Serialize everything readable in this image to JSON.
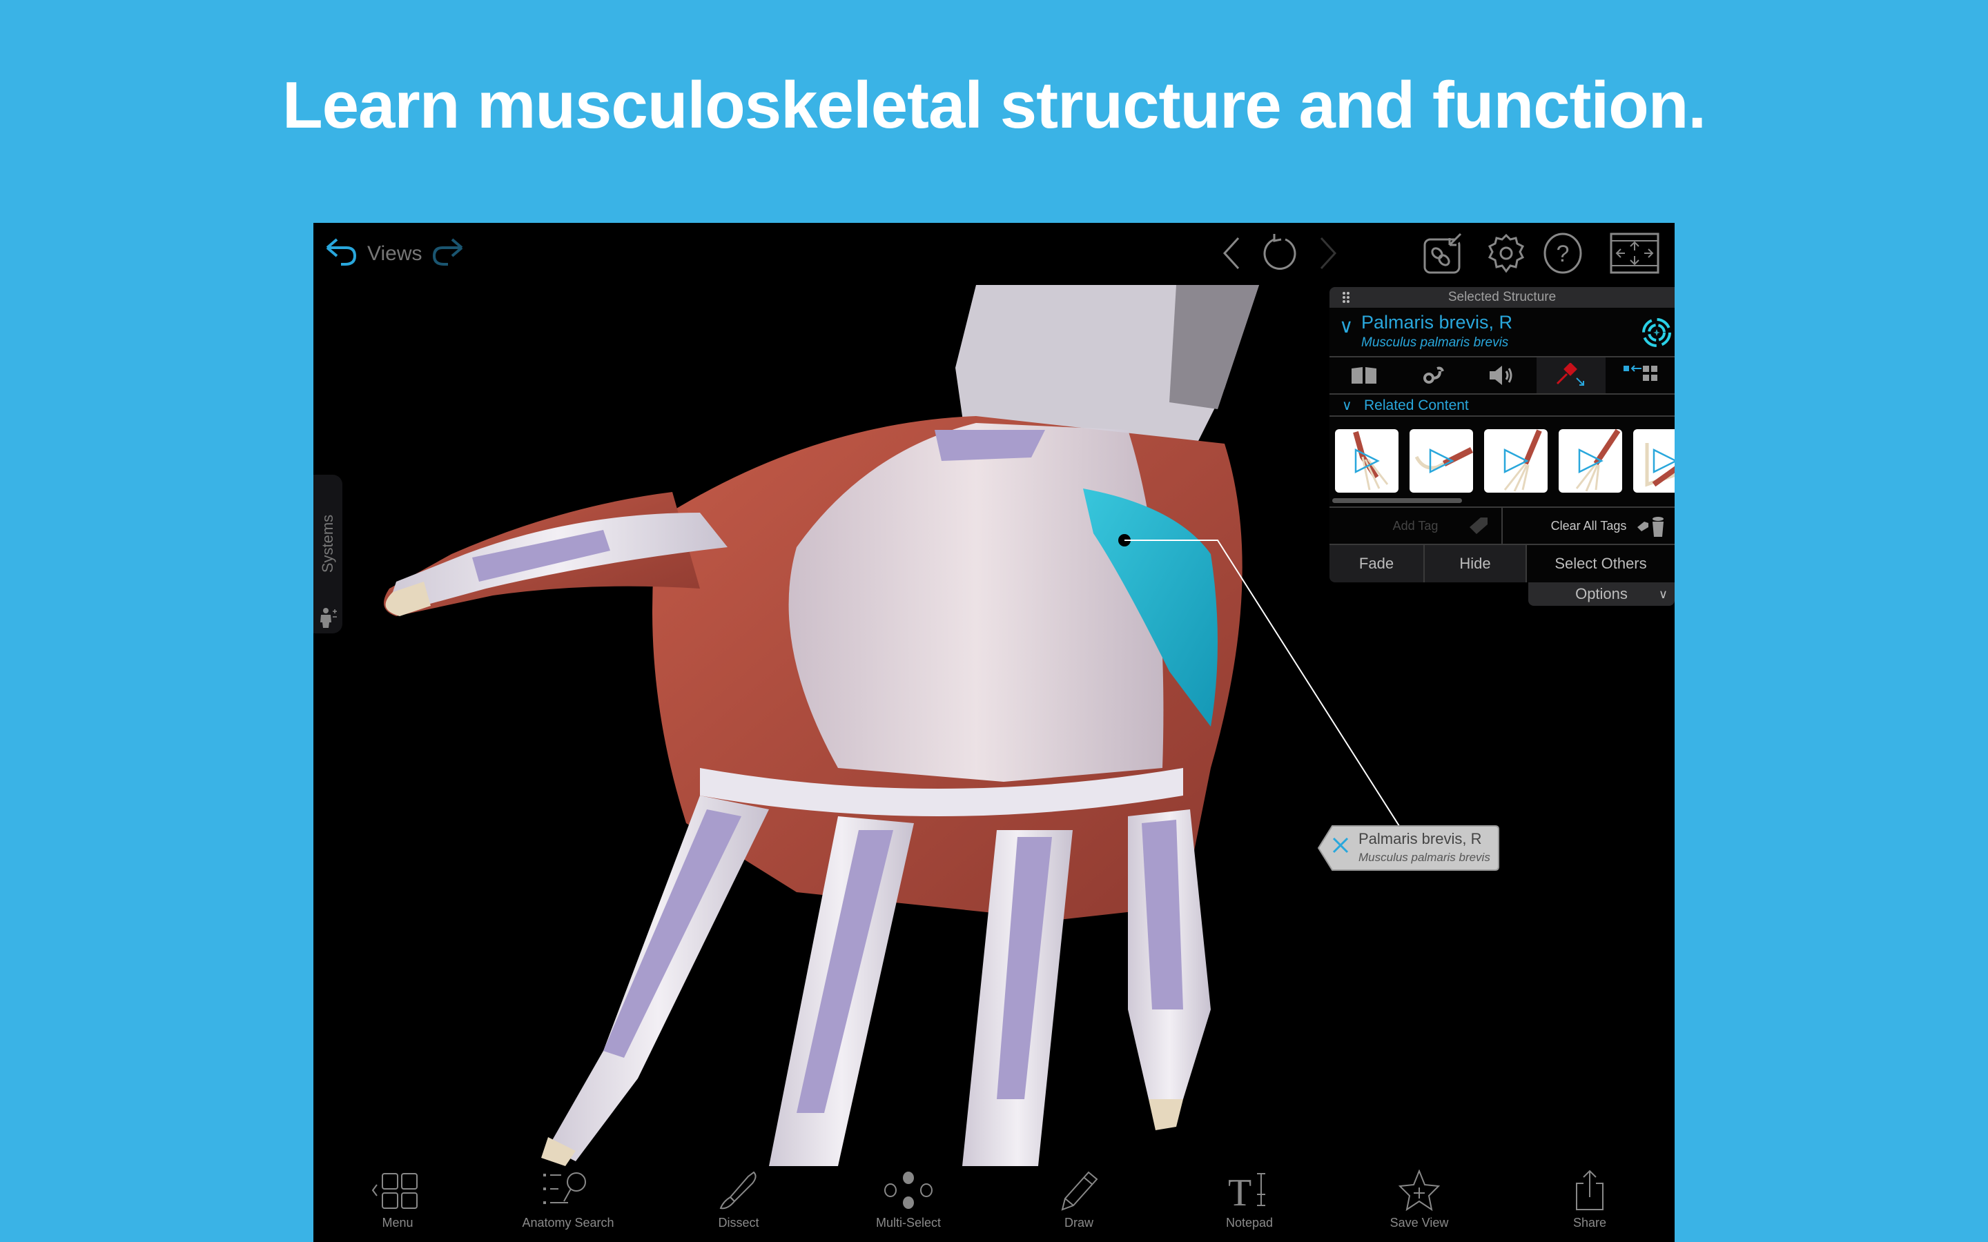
{
  "headline": "Learn musculoskeletal structure and function.",
  "colors": {
    "background": "#3ab3e6",
    "accent": "#29a7dc",
    "selected_muscle": "#1fb3cf",
    "muscle": "#b04a3c",
    "tendon": "#e8e4ec",
    "nerve_vessel": "#9a8ec4",
    "bone": "#e6d8be",
    "pin_red": "#c8101a"
  },
  "topbar": {
    "views_label": "Views",
    "icons": [
      "undo-icon",
      "redo-icon",
      "back-icon",
      "reset-rotation-icon",
      "forward-icon",
      "link-icon",
      "settings-icon",
      "help-icon",
      "fullscreen-icon"
    ]
  },
  "systems_tab": {
    "label": "Systems"
  },
  "panel": {
    "header": "Selected Structure",
    "structure_name": "Palmaris brevis, R",
    "structure_latin": "Musculus palmaris brevis",
    "tools": [
      "book-icon",
      "stethoscope-icon",
      "audio-icon",
      "pin-icon",
      "isolate-icon"
    ],
    "related_label": "Related Content",
    "thumbnails": [
      {
        "name": "animation-1"
      },
      {
        "name": "animation-2"
      },
      {
        "name": "animation-3"
      },
      {
        "name": "animation-4"
      },
      {
        "name": "animation-5"
      }
    ],
    "add_tag": "Add Tag",
    "clear_tags": "Clear All Tags",
    "fade": "Fade",
    "hide": "Hide",
    "select_others": "Select Others",
    "options": "Options"
  },
  "pin_label": {
    "name": "Palmaris brevis, R",
    "latin": "Musculus palmaris brevis"
  },
  "bottombar": {
    "items": [
      {
        "label": "Menu",
        "icon": "menu-icon"
      },
      {
        "label": "Anatomy Search",
        "icon": "anatomy-search-icon"
      },
      {
        "label": "Dissect",
        "icon": "scalpel-icon"
      },
      {
        "label": "Multi-Select",
        "icon": "multi-select-icon"
      },
      {
        "label": "Draw",
        "icon": "pencil-icon"
      },
      {
        "label": "Notepad",
        "icon": "notepad-icon"
      },
      {
        "label": "Save View",
        "icon": "save-view-icon"
      },
      {
        "label": "Share",
        "icon": "share-icon"
      }
    ]
  }
}
